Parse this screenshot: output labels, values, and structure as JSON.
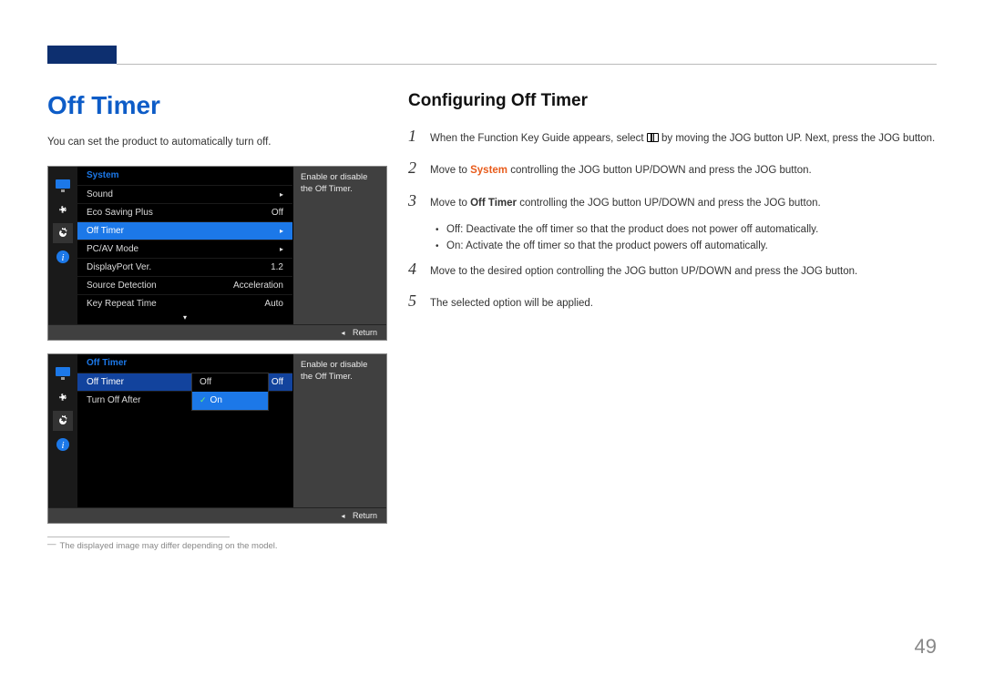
{
  "left": {
    "heading": "Off Timer",
    "intro": "You can set the product to automatically turn off."
  },
  "osd1": {
    "menu_title": "System",
    "rows": [
      {
        "label": "Sound",
        "value": "▸"
      },
      {
        "label": "Eco Saving Plus",
        "value": "Off"
      },
      {
        "label": "Off Timer",
        "value": "▸",
        "selected": true
      },
      {
        "label": "PC/AV Mode",
        "value": "▸"
      },
      {
        "label": "DisplayPort Ver.",
        "value": "1.2"
      },
      {
        "label": "Source Detection",
        "value": "Acceleration"
      },
      {
        "label": "Key Repeat Time",
        "value": "Auto"
      }
    ],
    "tooltip": "Enable or disable the Off Timer.",
    "footer": "Return"
  },
  "osd2": {
    "menu_title": "Off Timer",
    "rows": [
      {
        "label": "Off Timer",
        "value": "Off",
        "selected": true
      },
      {
        "label": "Turn Off After",
        "value": ""
      }
    ],
    "popup": {
      "off": "Off",
      "on": "On"
    },
    "tooltip": "Enable or disable the Off Timer.",
    "footer": "Return"
  },
  "footnote": "The displayed image may differ depending on the model.",
  "right": {
    "heading": "Configuring Off Timer",
    "step1_a": "When the Function Key Guide appears, select ",
    "step1_b": " by moving the JOG button UP. Next, press the JOG button.",
    "step2_a": "Move to ",
    "step2_sys": "System",
    "step2_b": " controlling the JOG button UP/DOWN and press the JOG button.",
    "step3_a": "Move to ",
    "step3_off": "Off Timer",
    "step3_b": " controlling the JOG button UP/DOWN and press the JOG button.",
    "bullet_off_kw": "Off",
    "bullet_off_text": ": Deactivate the off timer so that the product does not power off automatically.",
    "bullet_on_kw": "On",
    "bullet_on_text": ": Activate the off timer so that the product powers off automatically.",
    "step4": "Move to the desired option controlling the JOG button UP/DOWN and press the JOG button.",
    "step5": "The selected option will be applied."
  },
  "page_number": "49"
}
